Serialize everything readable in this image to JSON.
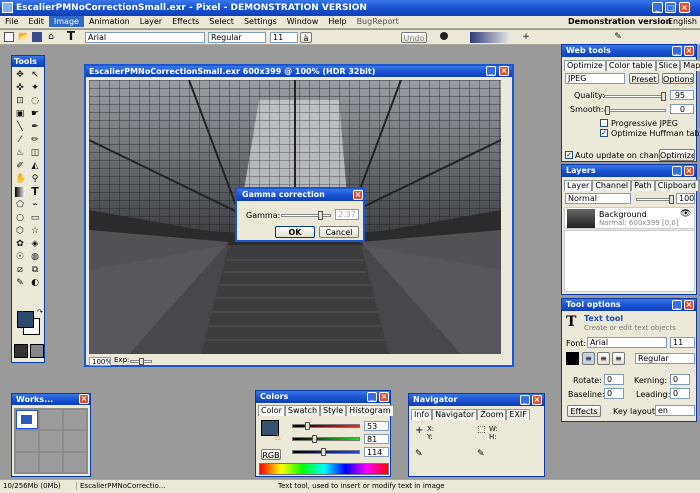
{
  "app": {
    "title": "EscalierPMNoCorrectionSmall.exr - Pixel - DEMONSTRATION VERSION"
  },
  "menu": {
    "items": [
      "File",
      "Edit",
      "Image",
      "Animation",
      "Layer",
      "Effects",
      "Select",
      "Settings",
      "Window",
      "Help",
      "BugReport"
    ],
    "demo": "Demonstration version",
    "lang": "English"
  },
  "toolbar": {
    "font": "Arial",
    "style": "Regular",
    "size": "11",
    "undo": "Undo"
  },
  "tools_panel": {
    "title": "Tools"
  },
  "image_window": {
    "title": "EscalierPMNoCorrectionSmall.exr 600x399 @ 100% (HDR 32bit)",
    "zoom": "100%",
    "exp": "Exp:"
  },
  "gamma_dialog": {
    "title": "Gamma correction",
    "label": "Gamma:",
    "value": "2.37",
    "ok": "OK",
    "cancel": "Cancel"
  },
  "web_tools": {
    "title": "Web tools",
    "tabs": [
      "Optimize",
      "Color table",
      "Slice",
      "Map"
    ],
    "format": "JPEG",
    "preset": "Preset",
    "options": "Options",
    "quality_label": "Quality:",
    "quality": "95",
    "smooth_label": "Smooth:",
    "smooth": "0",
    "progressive": "Progressive JPEG",
    "huffman": "Optimize Huffman table",
    "auto_update": "Auto update on change",
    "optimize": "Optimize"
  },
  "layers": {
    "title": "Layers",
    "tabs": [
      "Layer",
      "Channel",
      "Path",
      "Clipboard"
    ],
    "blend": "Normal",
    "opacity": "100",
    "layer_name": "Background",
    "layer_info": "Normal: 600x399 [0,0]"
  },
  "tool_options": {
    "title": "Tool options",
    "tool_name": "Text tool",
    "tool_desc": "Create or edit text objects",
    "font_label": "Font:",
    "font": "Arial",
    "size": "11",
    "style": "Regular",
    "rotate_label": "Rotate:",
    "rotate": "0",
    "kerning_label": "Kerning:",
    "kerning": "0",
    "baseline_label": "Baseline:",
    "baseline": "0",
    "leading_label": "Leading:",
    "leading": "0",
    "effects": "Effects",
    "key_layout_label": "Key layout:",
    "key_layout": "en"
  },
  "workspace": {
    "title": "Works..."
  },
  "colors": {
    "title": "Colors",
    "tabs": [
      "Color",
      "Swatch",
      "Style",
      "Histogram"
    ],
    "r": "53",
    "g": "81",
    "b": "114",
    "mode": "RGB"
  },
  "navigator": {
    "title": "Navigator",
    "tabs": [
      "Info",
      "Navigator",
      "Zoom",
      "EXIF"
    ],
    "x": "X:",
    "y": "Y:",
    "w": "W:",
    "h": "H:"
  },
  "status": {
    "memory": "10/256Mb (0Mb)",
    "file": "EscalierPMNoCorrectio...",
    "message": "Text tool, used to insert or modify text in image"
  }
}
